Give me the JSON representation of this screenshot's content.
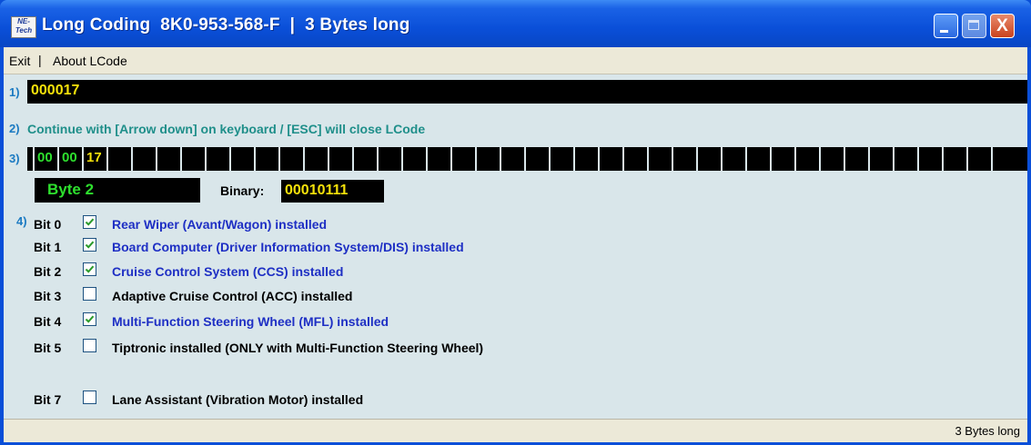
{
  "window": {
    "title": "Long Coding  8K0-953-568-F  |  3 Bytes long",
    "icon_text_top": "NE-",
    "icon_text_bottom": "Tech",
    "close_glyph": "X"
  },
  "menu": {
    "exit": "Exit",
    "separator": "|",
    "about": "About LCode"
  },
  "step_labels": {
    "s1": "1)",
    "s2": "2)",
    "s3": "3)",
    "s4": "4)"
  },
  "coding_value": "000017",
  "hint": "Continue with [Arrow down] on keyboard / [ESC] will close LCode",
  "bytes": [
    "00",
    "00",
    "17"
  ],
  "selected_byte": {
    "label": "Byte 2",
    "binary_label": "Binary:",
    "binary_value": "00010111"
  },
  "bits": [
    {
      "label": "Bit 0",
      "checked": true,
      "text": "Rear Wiper (Avant/Wagon) installed"
    },
    {
      "label": "Bit 1",
      "checked": true,
      "text": "Board Computer (Driver Information System/DIS) installed"
    },
    {
      "label": "Bit 2",
      "checked": true,
      "text": "Cruise Control System (CCS) installed"
    },
    {
      "label": "Bit 3",
      "checked": false,
      "text": "Adaptive Cruise Control (ACC) installed"
    },
    {
      "label": "Bit 4",
      "checked": true,
      "text": "Multi-Function Steering Wheel (MFL) installed"
    },
    {
      "label": "Bit 5",
      "checked": false,
      "text": "Tiptronic installed (ONLY with Multi-Function Steering Wheel)"
    },
    {
      "label": "Bit 7",
      "checked": false,
      "text": "Lane Assistant (Vibration Motor) installed"
    }
  ],
  "status": "3 Bytes long",
  "colors": {
    "checked_text": "#1e2fc4",
    "byte_green": "#2ee02e",
    "value_yellow": "#f4e10a"
  }
}
